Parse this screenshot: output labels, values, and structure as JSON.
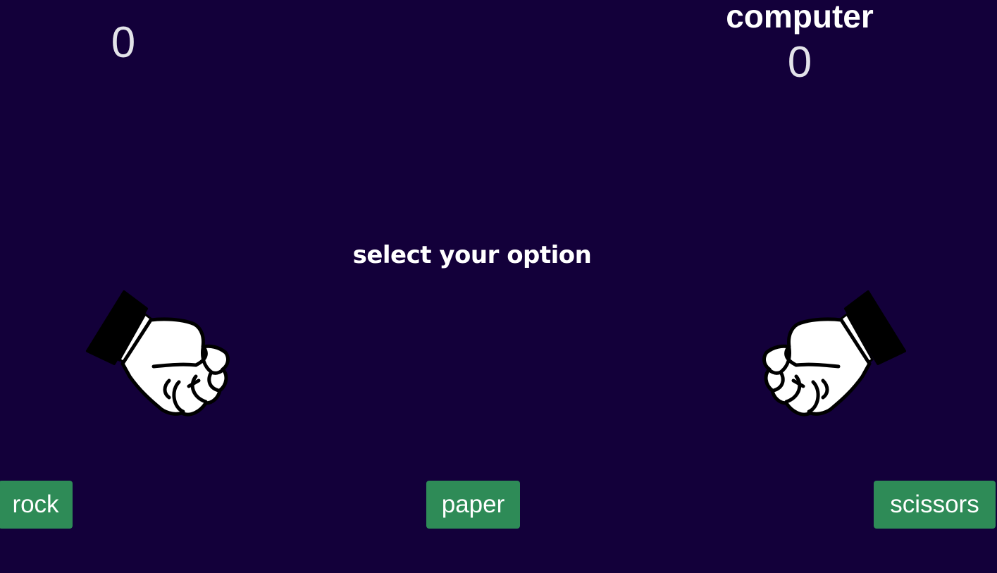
{
  "scores": {
    "player": "0",
    "computer_label": "computer",
    "computer": "0"
  },
  "prompt": "select your option",
  "hands": {
    "player": "fist-icon",
    "computer": "fist-icon"
  },
  "buttons": {
    "rock": "rock",
    "paper": "paper",
    "scissors": "scissors"
  },
  "colors": {
    "background": "#13003a",
    "button": "#2e8b57",
    "text": "#ffffff",
    "score": "#e3e3e9"
  }
}
